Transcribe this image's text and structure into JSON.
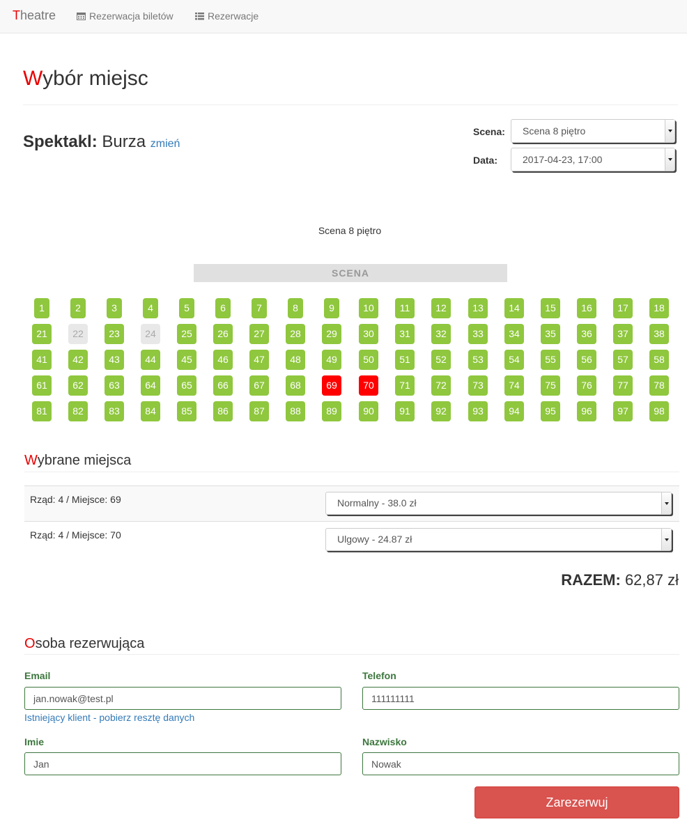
{
  "nav": {
    "brand_first": "T",
    "brand_rest": "heatre",
    "items": [
      {
        "label": "Rezerwacja biletów",
        "icon": "calendar-icon"
      },
      {
        "label": "Rezerwacje",
        "icon": "list-icon"
      }
    ]
  },
  "page": {
    "title_first": "W",
    "title_rest": "ybór miejsc"
  },
  "show": {
    "label": "Spektakl:",
    "name": "Burza",
    "change_link": "zmień"
  },
  "filters": {
    "scene_label": "Scena:",
    "scene_value": "Scena 8 piętro",
    "date_label": "Data:",
    "date_value": "2017-04-23, 17:00"
  },
  "hall": {
    "scene_name": "Scena 8 piętro",
    "stage_label": "SCENA",
    "rows": [
      [
        {
          "n": "1",
          "s": "free"
        },
        {
          "n": "2",
          "s": "free"
        },
        {
          "n": "3",
          "s": "free"
        },
        {
          "n": "4",
          "s": "free"
        },
        {
          "n": "5",
          "s": "free"
        },
        {
          "n": "6",
          "s": "free"
        },
        {
          "n": "7",
          "s": "free"
        },
        {
          "n": "8",
          "s": "free"
        },
        {
          "n": "9",
          "s": "free"
        },
        {
          "n": "10",
          "s": "free"
        },
        {
          "n": "11",
          "s": "free"
        },
        {
          "n": "12",
          "s": "free"
        },
        {
          "n": "13",
          "s": "free"
        },
        {
          "n": "14",
          "s": "free"
        },
        {
          "n": "15",
          "s": "free"
        },
        {
          "n": "16",
          "s": "free"
        },
        {
          "n": "17",
          "s": "free"
        },
        {
          "n": "18",
          "s": "free"
        }
      ],
      [
        {
          "n": "21",
          "s": "free"
        },
        {
          "n": "22",
          "s": "taken"
        },
        {
          "n": "23",
          "s": "free"
        },
        {
          "n": "24",
          "s": "taken"
        },
        {
          "n": "25",
          "s": "free"
        },
        {
          "n": "26",
          "s": "free"
        },
        {
          "n": "27",
          "s": "free"
        },
        {
          "n": "28",
          "s": "free"
        },
        {
          "n": "29",
          "s": "free"
        },
        {
          "n": "30",
          "s": "free"
        },
        {
          "n": "31",
          "s": "free"
        },
        {
          "n": "32",
          "s": "free"
        },
        {
          "n": "33",
          "s": "free"
        },
        {
          "n": "34",
          "s": "free"
        },
        {
          "n": "35",
          "s": "free"
        },
        {
          "n": "36",
          "s": "free"
        },
        {
          "n": "37",
          "s": "free"
        },
        {
          "n": "38",
          "s": "free"
        }
      ],
      [
        {
          "n": "41",
          "s": "free"
        },
        {
          "n": "42",
          "s": "free"
        },
        {
          "n": "43",
          "s": "free"
        },
        {
          "n": "44",
          "s": "free"
        },
        {
          "n": "45",
          "s": "free"
        },
        {
          "n": "46",
          "s": "free"
        },
        {
          "n": "47",
          "s": "free"
        },
        {
          "n": "48",
          "s": "free"
        },
        {
          "n": "49",
          "s": "free"
        },
        {
          "n": "50",
          "s": "free"
        },
        {
          "n": "51",
          "s": "free"
        },
        {
          "n": "52",
          "s": "free"
        },
        {
          "n": "53",
          "s": "free"
        },
        {
          "n": "54",
          "s": "free"
        },
        {
          "n": "55",
          "s": "free"
        },
        {
          "n": "56",
          "s": "free"
        },
        {
          "n": "57",
          "s": "free"
        },
        {
          "n": "58",
          "s": "free"
        }
      ],
      [
        {
          "n": "61",
          "s": "free"
        },
        {
          "n": "62",
          "s": "free"
        },
        {
          "n": "63",
          "s": "free"
        },
        {
          "n": "64",
          "s": "free"
        },
        {
          "n": "65",
          "s": "free"
        },
        {
          "n": "66",
          "s": "free"
        },
        {
          "n": "67",
          "s": "free"
        },
        {
          "n": "68",
          "s": "free"
        },
        {
          "n": "69",
          "s": "selected"
        },
        {
          "n": "70",
          "s": "selected"
        },
        {
          "n": "71",
          "s": "free"
        },
        {
          "n": "72",
          "s": "free"
        },
        {
          "n": "73",
          "s": "free"
        },
        {
          "n": "74",
          "s": "free"
        },
        {
          "n": "75",
          "s": "free"
        },
        {
          "n": "76",
          "s": "free"
        },
        {
          "n": "77",
          "s": "free"
        },
        {
          "n": "78",
          "s": "free"
        }
      ],
      [
        {
          "n": "81",
          "s": "free"
        },
        {
          "n": "82",
          "s": "free"
        },
        {
          "n": "83",
          "s": "free"
        },
        {
          "n": "84",
          "s": "free"
        },
        {
          "n": "85",
          "s": "free"
        },
        {
          "n": "86",
          "s": "free"
        },
        {
          "n": "87",
          "s": "free"
        },
        {
          "n": "88",
          "s": "free"
        },
        {
          "n": "89",
          "s": "free"
        },
        {
          "n": "90",
          "s": "free"
        },
        {
          "n": "91",
          "s": "free"
        },
        {
          "n": "92",
          "s": "free"
        },
        {
          "n": "93",
          "s": "free"
        },
        {
          "n": "94",
          "s": "free"
        },
        {
          "n": "95",
          "s": "free"
        },
        {
          "n": "96",
          "s": "free"
        },
        {
          "n": "97",
          "s": "free"
        },
        {
          "n": "98",
          "s": "free"
        }
      ]
    ],
    "colors": {
      "free": "#8fc73e",
      "taken": "#e8e8e8",
      "selected": "#ff0000"
    }
  },
  "selected": {
    "title_first": "W",
    "title_rest": "ybrane miejsca",
    "items": [
      {
        "label": "Rząd: 4 / Miejsce: 69",
        "ticket": "Normalny - 38.0 zł"
      },
      {
        "label": "Rząd: 4 / Miejsce: 70",
        "ticket": "Ulgowy - 24.87 zł"
      }
    ],
    "total_label": "RAZEM:",
    "total_value": "62,87 zł"
  },
  "customer": {
    "title_first": "O",
    "title_rest": "soba rezerwująca",
    "email_label": "Email",
    "email_value": "jan.nowak@test.pl",
    "existing_link": "Istniejący klient - pobierz resztę danych",
    "phone_label": "Telefon",
    "phone_value": "111111111",
    "first_name_label": "Imie",
    "first_name_value": "Jan",
    "last_name_label": "Nazwisko",
    "last_name_value": "Nowak",
    "submit_label": "Zarezerwuj"
  }
}
